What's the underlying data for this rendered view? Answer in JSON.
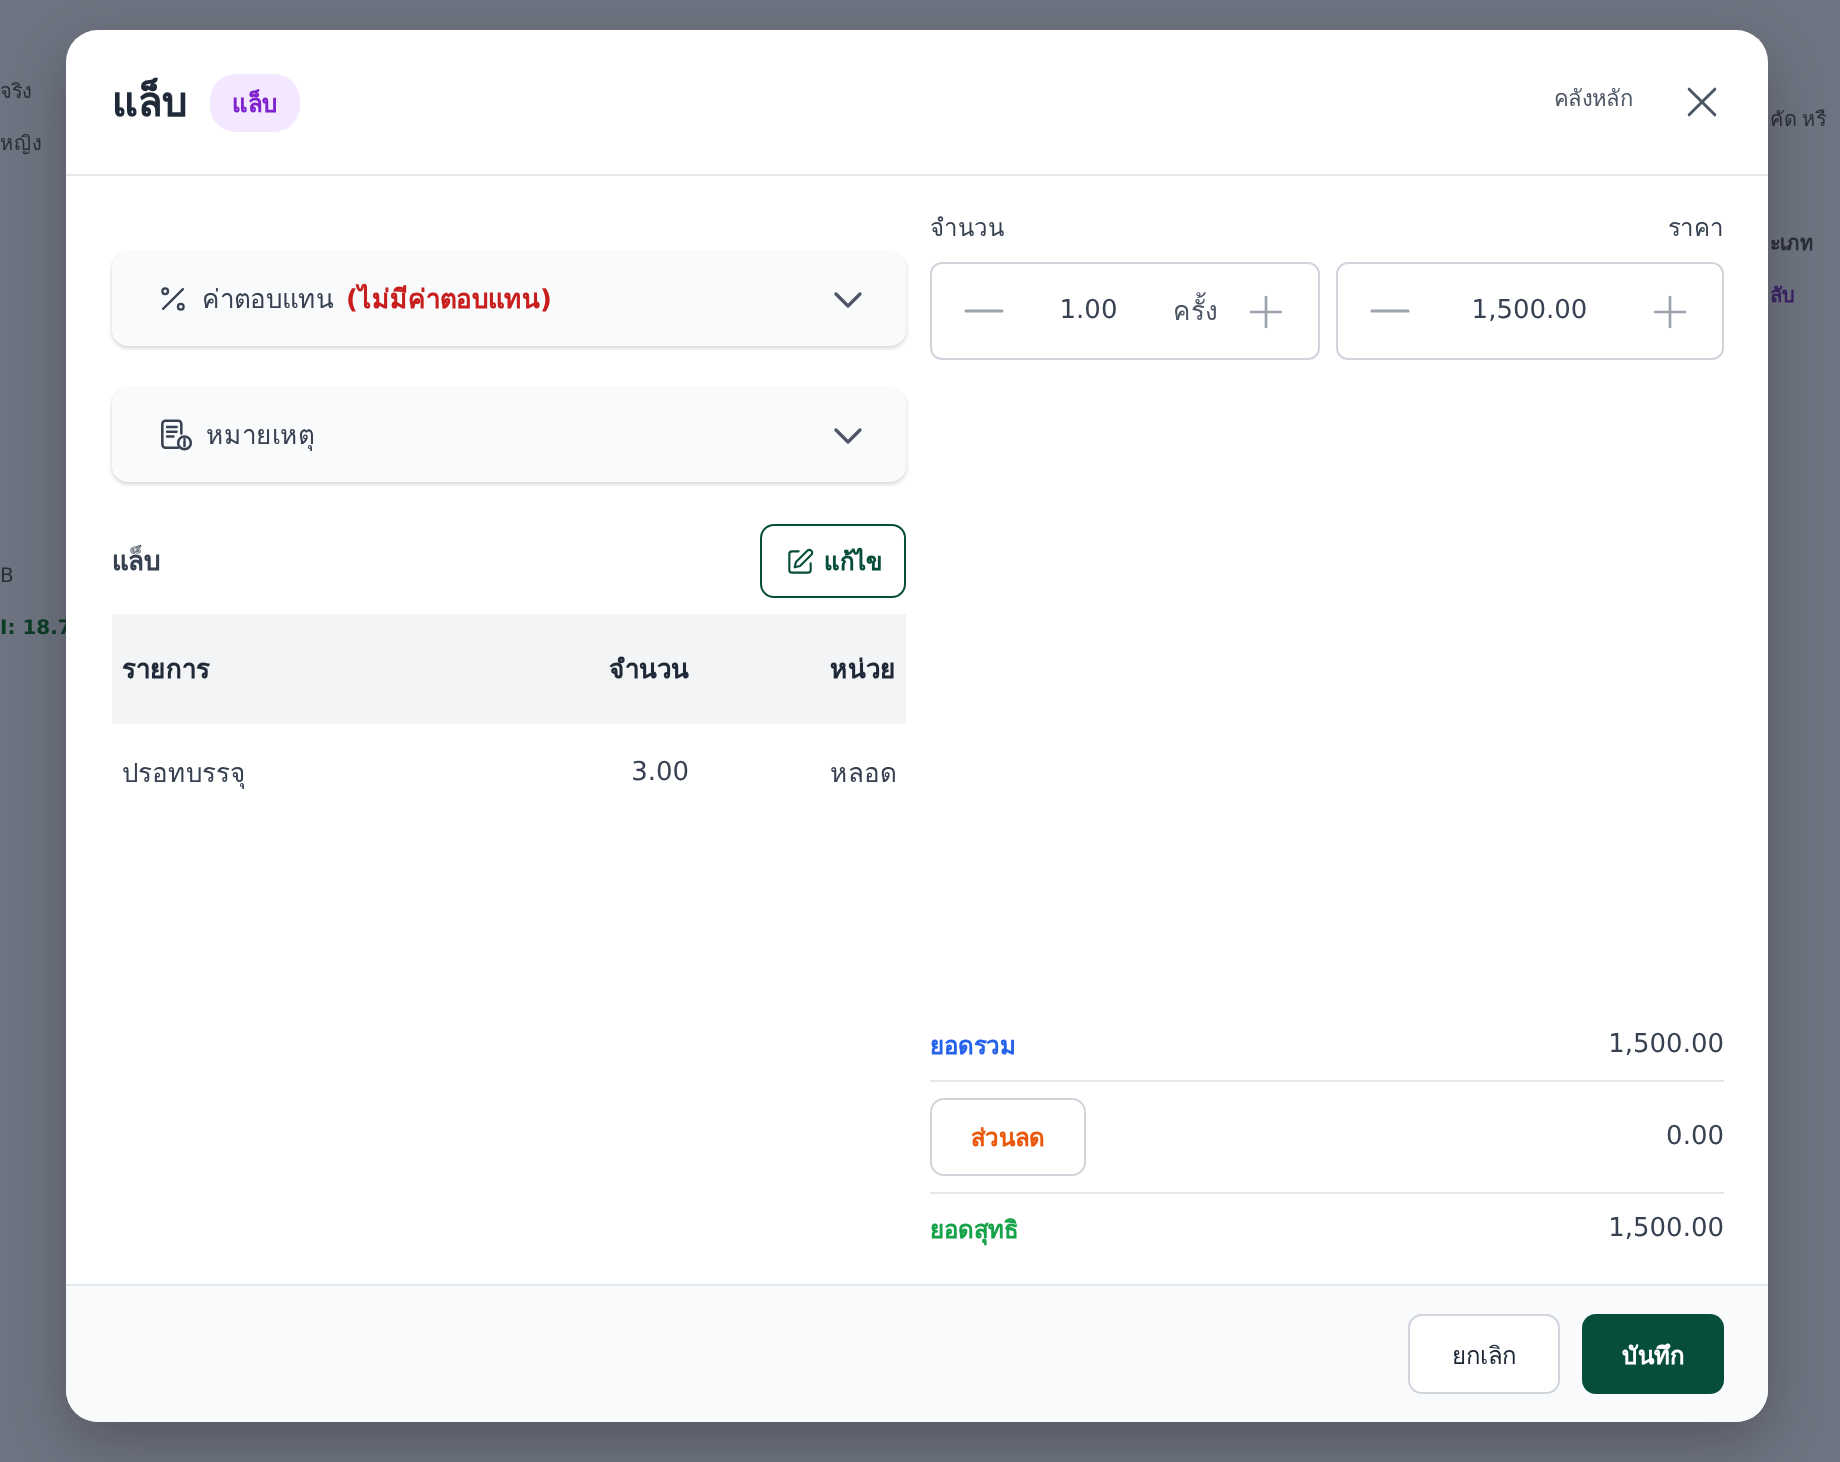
{
  "background": {
    "left_fragments": [
      "จริง",
      "หญิง",
      "B",
      "I: 18.7"
    ],
    "right_fragments": [
      "คัด หรื",
      "ะเภท",
      "ลับ"
    ]
  },
  "dialog": {
    "title": "แล็บ",
    "badge": "แล็บ",
    "warehouse": "คลังหลัก",
    "sections": [
      {
        "kind": "fee",
        "label": "ค่าตอบแทน",
        "note": "(ไม่มีค่าตอบแทน)",
        "expanded": false
      },
      {
        "kind": "remark",
        "label": "หมายเหตุ",
        "expanded": false
      }
    ],
    "lab": {
      "title": "แล็บ",
      "edit_button": "แก้ไข",
      "columns": [
        "รายการ",
        "จำนวน",
        "หน่วย"
      ],
      "rows": [
        [
          "ปรอทบรรจุ",
          "3.00",
          "หลอด"
        ]
      ]
    },
    "quantity": {
      "label": "จำนวน",
      "value": "1.00",
      "unit": "ครั้ง"
    },
    "price": {
      "label": "ราคา",
      "value": "1,500.00"
    },
    "summary": {
      "total_label": "ยอดรวม",
      "total": "1,500.00",
      "discount_button": "ส่วนลด",
      "discount": "0.00",
      "net_label": "ยอดสุทธิ",
      "net": "1,500.00"
    },
    "buttons": {
      "cancel": "ยกเลิก",
      "save": "บันทึก"
    }
  }
}
